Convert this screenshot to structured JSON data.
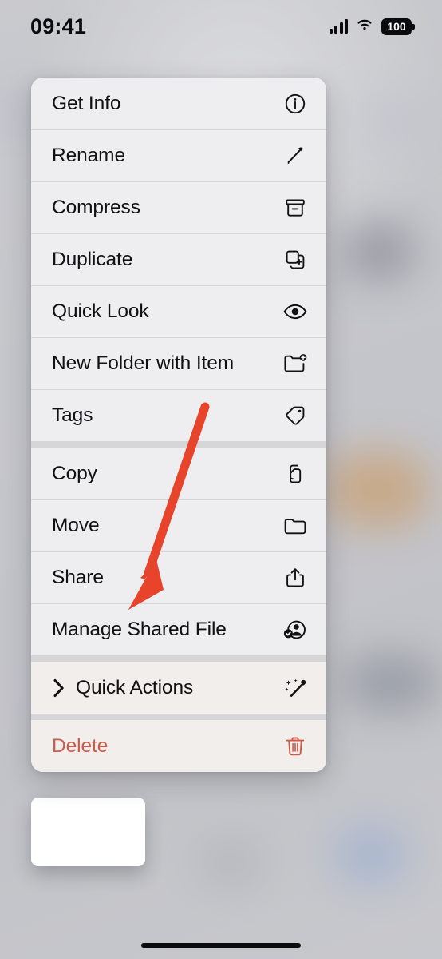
{
  "status_bar": {
    "time": "09:41",
    "cellular_icon": "cellular-bars-icon",
    "wifi_icon": "wifi-icon",
    "battery_level": "100",
    "battery_icon": "battery-full-icon"
  },
  "context_menu": {
    "groups": [
      {
        "id": "file-actions",
        "items": [
          {
            "label": "Get Info",
            "icon": "info-circle-icon",
            "destructive": false,
            "has_submenu": false
          },
          {
            "label": "Rename",
            "icon": "pencil-icon",
            "destructive": false,
            "has_submenu": false
          },
          {
            "label": "Compress",
            "icon": "archive-box-icon",
            "destructive": false,
            "has_submenu": false
          },
          {
            "label": "Duplicate",
            "icon": "duplicate-plus-icon",
            "destructive": false,
            "has_submenu": false
          },
          {
            "label": "Quick Look",
            "icon": "eye-icon",
            "destructive": false,
            "has_submenu": false
          },
          {
            "label": "New Folder with Item",
            "icon": "folder-badge-plus-icon",
            "destructive": false,
            "has_submenu": false
          },
          {
            "label": "Tags",
            "icon": "tag-icon",
            "destructive": false,
            "has_submenu": false
          }
        ]
      },
      {
        "id": "sharing-actions",
        "items": [
          {
            "label": "Copy",
            "icon": "doc-on-doc-icon",
            "destructive": false,
            "has_submenu": false
          },
          {
            "label": "Move",
            "icon": "folder-icon",
            "destructive": false,
            "has_submenu": false
          },
          {
            "label": "Share",
            "icon": "share-up-arrow-icon",
            "destructive": false,
            "has_submenu": false
          },
          {
            "label": "Manage Shared File",
            "icon": "person-checkmark-icon",
            "destructive": false,
            "has_submenu": false
          }
        ]
      },
      {
        "id": "quick-actions",
        "items": [
          {
            "label": "Quick Actions",
            "icon": "magic-wand-sparkles-icon",
            "destructive": false,
            "has_submenu": true
          }
        ]
      },
      {
        "id": "destructive-actions",
        "items": [
          {
            "label": "Delete",
            "icon": "trash-icon",
            "destructive": true,
            "has_submenu": false
          }
        ]
      }
    ]
  },
  "annotation": {
    "arrow_icon": "red-arrow-pointer",
    "color": "#E8442B",
    "points_at": "Manage Shared File"
  },
  "preview": {
    "thumbnail_name": "file-thumbnail",
    "color": "#FFFFFF"
  },
  "home_indicator": {
    "name": "home-indicator"
  },
  "colors": {
    "menu_background": "#EEEEF0",
    "separator": "#D6D6D9",
    "label": "#111114",
    "destructive": "#CD5A4B",
    "accent_annotation": "#E8442B"
  }
}
